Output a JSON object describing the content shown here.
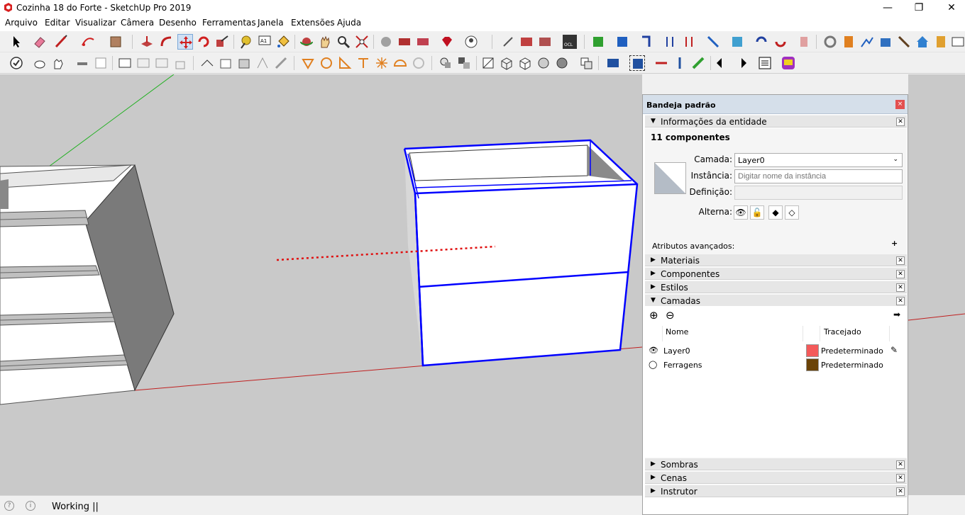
{
  "window": {
    "title": "Cozinha 18 do Forte - SketchUp Pro 2019",
    "minimize": "—",
    "maximize": "❐",
    "close": "✕"
  },
  "menu": [
    "Arquivo",
    "Editar",
    "Visualizar",
    "Câmera",
    "Desenho",
    "Ferramentas",
    "Janela",
    "Extensões",
    "Ajuda"
  ],
  "status": {
    "text": "Working ||",
    "geo_icon": "globe-icon",
    "info_icon": "info-icon"
  },
  "tray": {
    "title": "Bandeja padrão",
    "close": "×",
    "entity_info": {
      "header": "Informações da entidade",
      "count_label": "11 componentes",
      "layer_label": "Camada:",
      "layer_value": "Layer0",
      "instance_label": "Instância:",
      "instance_placeholder": "Digitar nome da instância",
      "definition_label": "Definição:",
      "toggles_label": "Alterna:",
      "advanced_label": "Atributos avançados:"
    },
    "sections": {
      "materials": "Materiais",
      "components": "Componentes",
      "styles": "Estilos",
      "layers": "Camadas",
      "shadows": "Sombras",
      "scenes": "Cenas",
      "instructor": "Instrutor"
    },
    "layers": {
      "col_name": "Nome",
      "col_dash": "Tracejado",
      "rows": [
        {
          "name": "Layer0",
          "color": "#f45a5a",
          "dash": "Predeterminado",
          "visible": true
        },
        {
          "name": "Ferragens",
          "color": "#6b4307",
          "dash": "Predeterminado",
          "visible": false
        }
      ]
    }
  },
  "colors": {
    "selection": "#0000ff",
    "red_axis": "#c02020",
    "green_axis": "#20b020",
    "viewport_bg": "#c9c9c9"
  }
}
